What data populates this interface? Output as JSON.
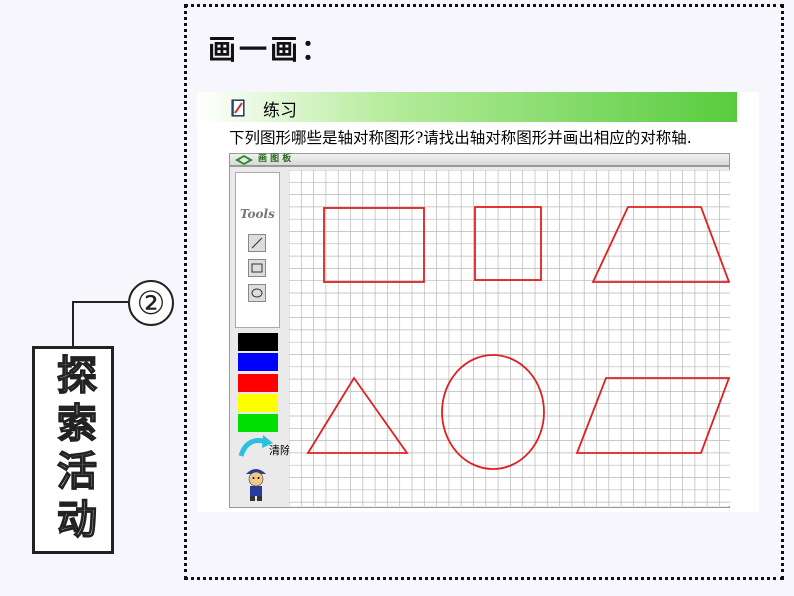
{
  "slide": {
    "heading": "画一画：",
    "step_number": "②",
    "section_label": "探索活动"
  },
  "exercise": {
    "title": "练习",
    "instruction": "下列图形哪些是轴对称图形?请找出轴对称图形并画出相应的对称轴.",
    "board_title": "画 图 板",
    "tools_label": "Tools",
    "tools": [
      "line-tool",
      "rectangle-tool",
      "ellipse-tool"
    ],
    "palette": [
      "#000000",
      "#0000ff",
      "#ff0000",
      "#ffff00",
      "#00e000"
    ],
    "selected_color": "#000000",
    "clear_label": "清除",
    "shape_color": "#e02020",
    "shapes": [
      "rectangle",
      "square",
      "trapezoid",
      "triangle",
      "circle",
      "parallelogram"
    ]
  }
}
